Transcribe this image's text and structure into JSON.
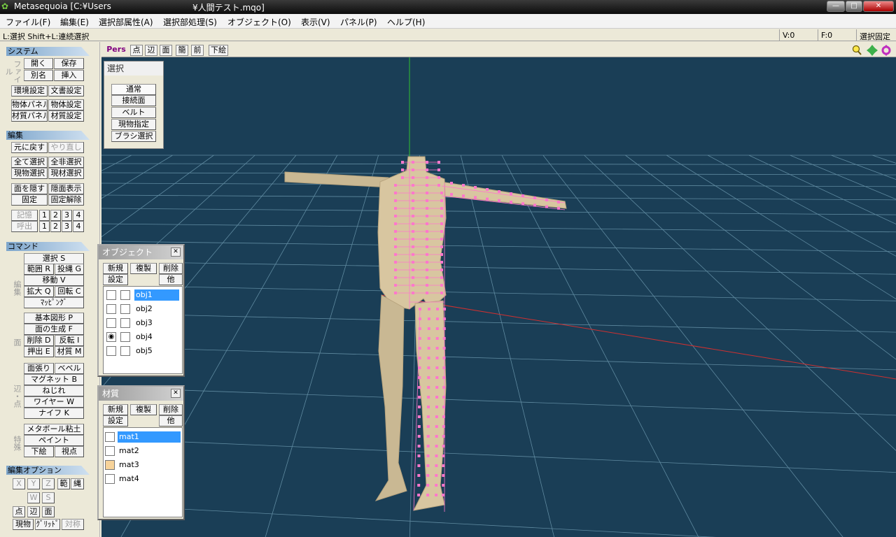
{
  "window": {
    "title": "Metasequoia [C:¥Users",
    "title_tail": "¥人間テスト.mqo]",
    "min_btn": "—",
    "max_btn": "□",
    "close_btn": "✕"
  },
  "menu": [
    "ファイル(F)",
    "編集(E)",
    "選択部属性(A)",
    "選択部処理(S)",
    "オブジェクト(O)",
    "表示(V)",
    "パネル(P)",
    "ヘルプ(H)"
  ],
  "status": {
    "hint": "L:選択  Shift+L:連続選択",
    "v": "V:0",
    "f": "F:0",
    "mode": "選択固定"
  },
  "left": {
    "system_hdr": "システム",
    "file_vlabel": "ファイル",
    "open": "開く",
    "save": "保存",
    "saveas": "別名",
    "insert": "挿入",
    "env_settings": "環境設定",
    "doc_settings": "文書設定",
    "obj_panel": "物体パネル",
    "obj_settings": "物体設定",
    "mat_panel": "材質パネル",
    "mat_settings": "材質設定",
    "edit_hdr": "編集",
    "undo": "元に戻す",
    "redo": "やり直し",
    "select_all": "全て選択",
    "deselect_all": "全非選択",
    "cur_obj_select": "現物選択",
    "cur_mat_select": "現材選択",
    "hide": "面を隠す",
    "show_hidden": "隠面表示",
    "lock": "固定",
    "unlock": "固定解除",
    "memory": "記憶",
    "recall": "呼出",
    "nums": [
      "1",
      "2",
      "3",
      "4"
    ],
    "command_hdr": "コマンド",
    "edit_vlabel": "編集",
    "cmd_select": "選択 S",
    "cmd_range": "範囲 R",
    "cmd_lasso": "投縄 G",
    "cmd_move": "移動 V",
    "cmd_scale": "拡大 Q",
    "cmd_rotate": "回転 C",
    "cmd_mapping": "ﾏｯﾋﾟﾝｸﾞ",
    "face_vlabel": "面",
    "cmd_primitive": "基本図形 P",
    "cmd_gen_face": "面の生成 F",
    "cmd_delete": "削除 D",
    "cmd_flip": "反転 I",
    "cmd_extrude": "押出 E",
    "cmd_material": "材質 M",
    "edge_vlabel": "辺・点",
    "cmd_face_paste": "面張り",
    "cmd_bevel": "ベベル",
    "cmd_magnet": "マグネット B",
    "cmd_twist": "ねじれ",
    "cmd_wire": "ワイヤー W",
    "cmd_knife": "ナイフ K",
    "special_vlabel": "特殊",
    "cmd_metaball": "メタボール粘土",
    "cmd_paint": "ペイント",
    "cmd_underlay": "下絵",
    "cmd_viewpoint": "視点",
    "editopt_hdr": "編集オプション",
    "opt_x": "X",
    "opt_y": "Y",
    "opt_z": "Z",
    "opt_range": "範",
    "opt_lasso": "縄",
    "opt_w": "W",
    "opt_s": "S",
    "opt_point": "点",
    "opt_edge": "辺",
    "opt_face": "面",
    "opt_curobj": "現物",
    "opt_grid": "ｸﾞﾘｯﾄﾞ",
    "opt_symm": "対称"
  },
  "viewbar": {
    "pers": "Pers",
    "point": "点",
    "edge": "辺",
    "face": "面",
    "simple": "簡",
    "front": "前",
    "underlay": "下絵",
    "zoom_icon": "magnifier-icon",
    "pan_icon": "pan-arrows-icon",
    "rotate_icon": "rotate-arrows-icon"
  },
  "select_panel": {
    "title": "選択",
    "normal": "通常",
    "connected": "接続面",
    "belt": "ベルト",
    "cur_obj": "現物指定",
    "brush": "ブラシ選択"
  },
  "object_panel": {
    "title": "オブジェクト",
    "new": "新規",
    "copy": "複製",
    "delete": "削除",
    "settings": "設定",
    "other": "他",
    "items": [
      {
        "name": "obj1",
        "visible": false,
        "selected": true
      },
      {
        "name": "obj2",
        "visible": false,
        "selected": false
      },
      {
        "name": "obj3",
        "visible": false,
        "selected": false
      },
      {
        "name": "obj4",
        "visible": true,
        "selected": false
      },
      {
        "name": "obj5",
        "visible": false,
        "selected": false
      }
    ]
  },
  "material_panel": {
    "title": "材質",
    "new": "新規",
    "copy": "複製",
    "delete": "削除",
    "settings": "設定",
    "other": "他",
    "items": [
      {
        "name": "mat1",
        "color": "#ffffff",
        "selected": true
      },
      {
        "name": "mat2",
        "color": "#ffffff",
        "selected": false
      },
      {
        "name": "mat3",
        "color": "#f7d39a",
        "selected": false
      },
      {
        "name": "mat4",
        "color": "#ffffff",
        "selected": false
      }
    ]
  },
  "colors": {
    "viewport_bg": "#1a3e56",
    "grid": "#5f8aa0",
    "skin": "#d8c6a0",
    "selection": "#ff77cc",
    "axis_x": "#d03030",
    "axis_y": "#30c030"
  }
}
